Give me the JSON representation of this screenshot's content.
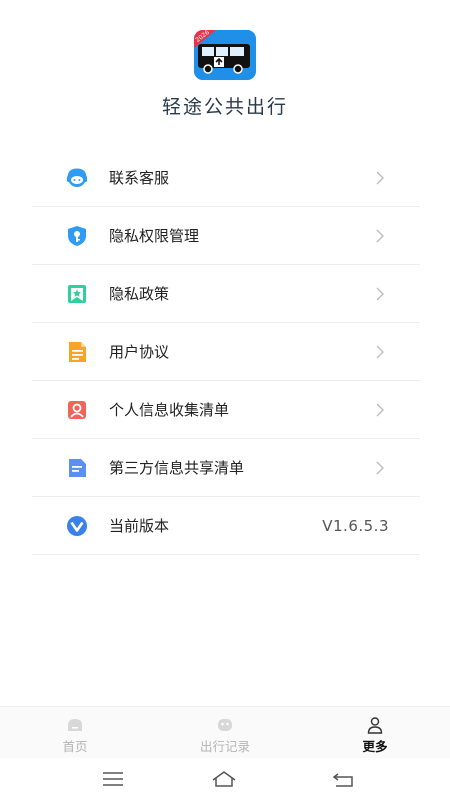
{
  "app": {
    "title": "轻途公共出行",
    "logo_badge": "2026"
  },
  "menu": [
    {
      "label": "联系客服",
      "icon": "customer-service-icon",
      "color": "#2e9cf2",
      "has_chevron": true
    },
    {
      "label": "隐私权限管理",
      "icon": "shield-key-icon",
      "color": "#2e9cf2",
      "has_chevron": true
    },
    {
      "label": "隐私政策",
      "icon": "bookmark-star-icon",
      "color": "#2fd19a",
      "has_chevron": true
    },
    {
      "label": "用户协议",
      "icon": "document-icon",
      "color": "#f5a623",
      "has_chevron": true
    },
    {
      "label": "个人信息收集清单",
      "icon": "person-card-icon",
      "color": "#f0645a",
      "has_chevron": true
    },
    {
      "label": "第三方信息共享清单",
      "icon": "list-document-icon",
      "color": "#5b8ff0",
      "has_chevron": true
    },
    {
      "label": "当前版本",
      "icon": "version-v-icon",
      "color": "#3b82e8",
      "has_chevron": false,
      "value": "V1.6.5.3"
    }
  ],
  "tabbar": {
    "tabs": [
      {
        "label": "首页",
        "icon": "home-icon",
        "active": false
      },
      {
        "label": "出行记录",
        "icon": "trip-record-icon",
        "active": false
      },
      {
        "label": "更多",
        "icon": "user-icon",
        "active": true
      }
    ]
  },
  "system_nav": {
    "buttons": [
      "menu-icon",
      "home-icon",
      "back-icon"
    ]
  }
}
